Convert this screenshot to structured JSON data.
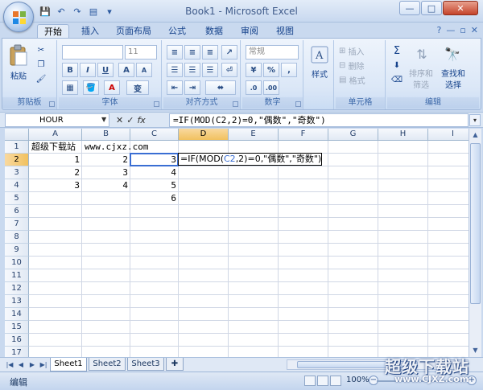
{
  "window": {
    "title": "Book1 - Microsoft Excel",
    "controls": {
      "minimize": "—",
      "maximize": "□",
      "close": "✕"
    }
  },
  "qat": {
    "save": "💾",
    "undo": "↶",
    "redo": "↷",
    "print_preview": "▤",
    "customize": "▾"
  },
  "tabs": [
    "开始",
    "插入",
    "页面布局",
    "公式",
    "数据",
    "审阅",
    "视图"
  ],
  "help": {
    "help": "?",
    "min": "—",
    "restore": "▫",
    "close": "✕"
  },
  "ribbon": {
    "clipboard": {
      "paste_label": "粘贴",
      "group_label": "剪贴板"
    },
    "font": {
      "font_name": "",
      "font_size": "11",
      "grow": "A",
      "shrink": "A",
      "bold": "B",
      "italic": "I",
      "underline": "U",
      "font_color": "A",
      "phonetic": "变",
      "group_label": "字体"
    },
    "alignment": {
      "group_label": "对齐方式"
    },
    "number": {
      "format": "常规",
      "percent": "%",
      "comma": ",",
      "group_label": "数字"
    },
    "styles": {
      "label": "样式"
    },
    "cells": {
      "insert": "插入",
      "delete": "删除",
      "format": "格式",
      "group_label": "单元格"
    },
    "editing": {
      "sum": "Σ",
      "sort_filter_1": "排序和",
      "sort_filter_2": "筛选",
      "find_select_1": "查找和",
      "find_select_2": "选择",
      "group_label": "编辑"
    }
  },
  "formula_bar": {
    "name_box": "HOUR",
    "cancel": "✕",
    "enter": "✓",
    "fx": "fx",
    "formula": "=IF(MOD(C2,2)=0,\"偶数\",\"奇数\")"
  },
  "grid": {
    "columns": [
      "A",
      "B",
      "C",
      "D",
      "E",
      "F",
      "G",
      "H",
      "I"
    ],
    "rows": [
      "1",
      "2",
      "3",
      "4",
      "5",
      "6",
      "7",
      "8",
      "9",
      "10",
      "11",
      "12",
      "13",
      "14",
      "15",
      "16",
      "17"
    ],
    "selected_column": "D",
    "selected_row": "2",
    "cells": {
      "A1": "超级下载站",
      "B1": "www.cjxz.com",
      "A2": "1",
      "B2": "2",
      "C2": "3",
      "A3": "2",
      "B3": "3",
      "C3": "4",
      "A4": "3",
      "B4": "4",
      "C4": "5",
      "C5": "6"
    },
    "edit_cell": {
      "part1": "=IF(MOD(",
      "ref": "C2",
      "part2": ",2)=0,\"偶数\",\"奇数\")"
    }
  },
  "sheets": [
    "Sheet1",
    "Sheet2",
    "Sheet3"
  ],
  "active_sheet": "Sheet1",
  "status": {
    "mode": "编辑",
    "zoom": "100%"
  },
  "watermark": {
    "big": "超级下载站",
    "url": "www.CJXZ.com"
  },
  "colors": {
    "selection": "#3a6ed3",
    "header_selected": "#f1c15f",
    "ribbon": "#dbe7f7"
  }
}
